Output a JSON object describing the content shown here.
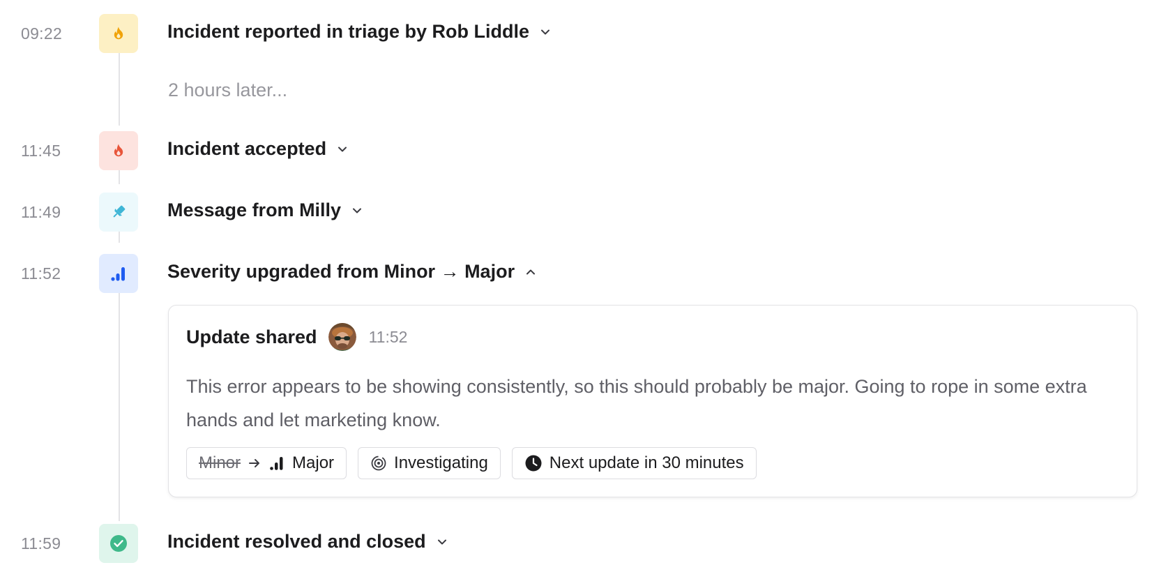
{
  "events": [
    {
      "time": "09:22",
      "title": "Incident reported in triage by Rob Liddle",
      "icon": "triage-flame-icon",
      "expanded": false
    },
    {
      "time": "11:45",
      "title": "Incident accepted",
      "icon": "flame-icon",
      "expanded": false
    },
    {
      "time": "11:49",
      "title": "Message from Milly",
      "icon": "pin-icon",
      "expanded": false
    },
    {
      "time": "11:52",
      "title": "Severity upgraded from Minor → Major",
      "icon": "severity-bars-icon",
      "expanded": true
    },
    {
      "time": "11:59",
      "title": "Incident resolved and closed",
      "icon": "check-circle-icon",
      "expanded": false
    }
  ],
  "gap_note": "2 hours later...",
  "update_card": {
    "title": "Update shared",
    "time": "11:52",
    "body": "This error appears to be showing consistently, so this should probably be major. Going to rope in some extra hands and let marketing know.",
    "severity_from": "Minor",
    "severity_to": "Major",
    "status": "Investigating",
    "next_update": "Next update in 30 minutes"
  },
  "colors": {
    "triage_bg": "#fdf0c4",
    "triage_fg": "#f0a30a",
    "accepted_bg": "#fde3df",
    "accepted_fg": "#e8553a",
    "message_bg": "#ecf9fc",
    "message_fg": "#3fb6d6",
    "severity_bg": "#e1ebff",
    "severity_fg": "#1f5cf0",
    "resolved_bg": "#dff5ec",
    "resolved_fg": "#3fb98a"
  }
}
